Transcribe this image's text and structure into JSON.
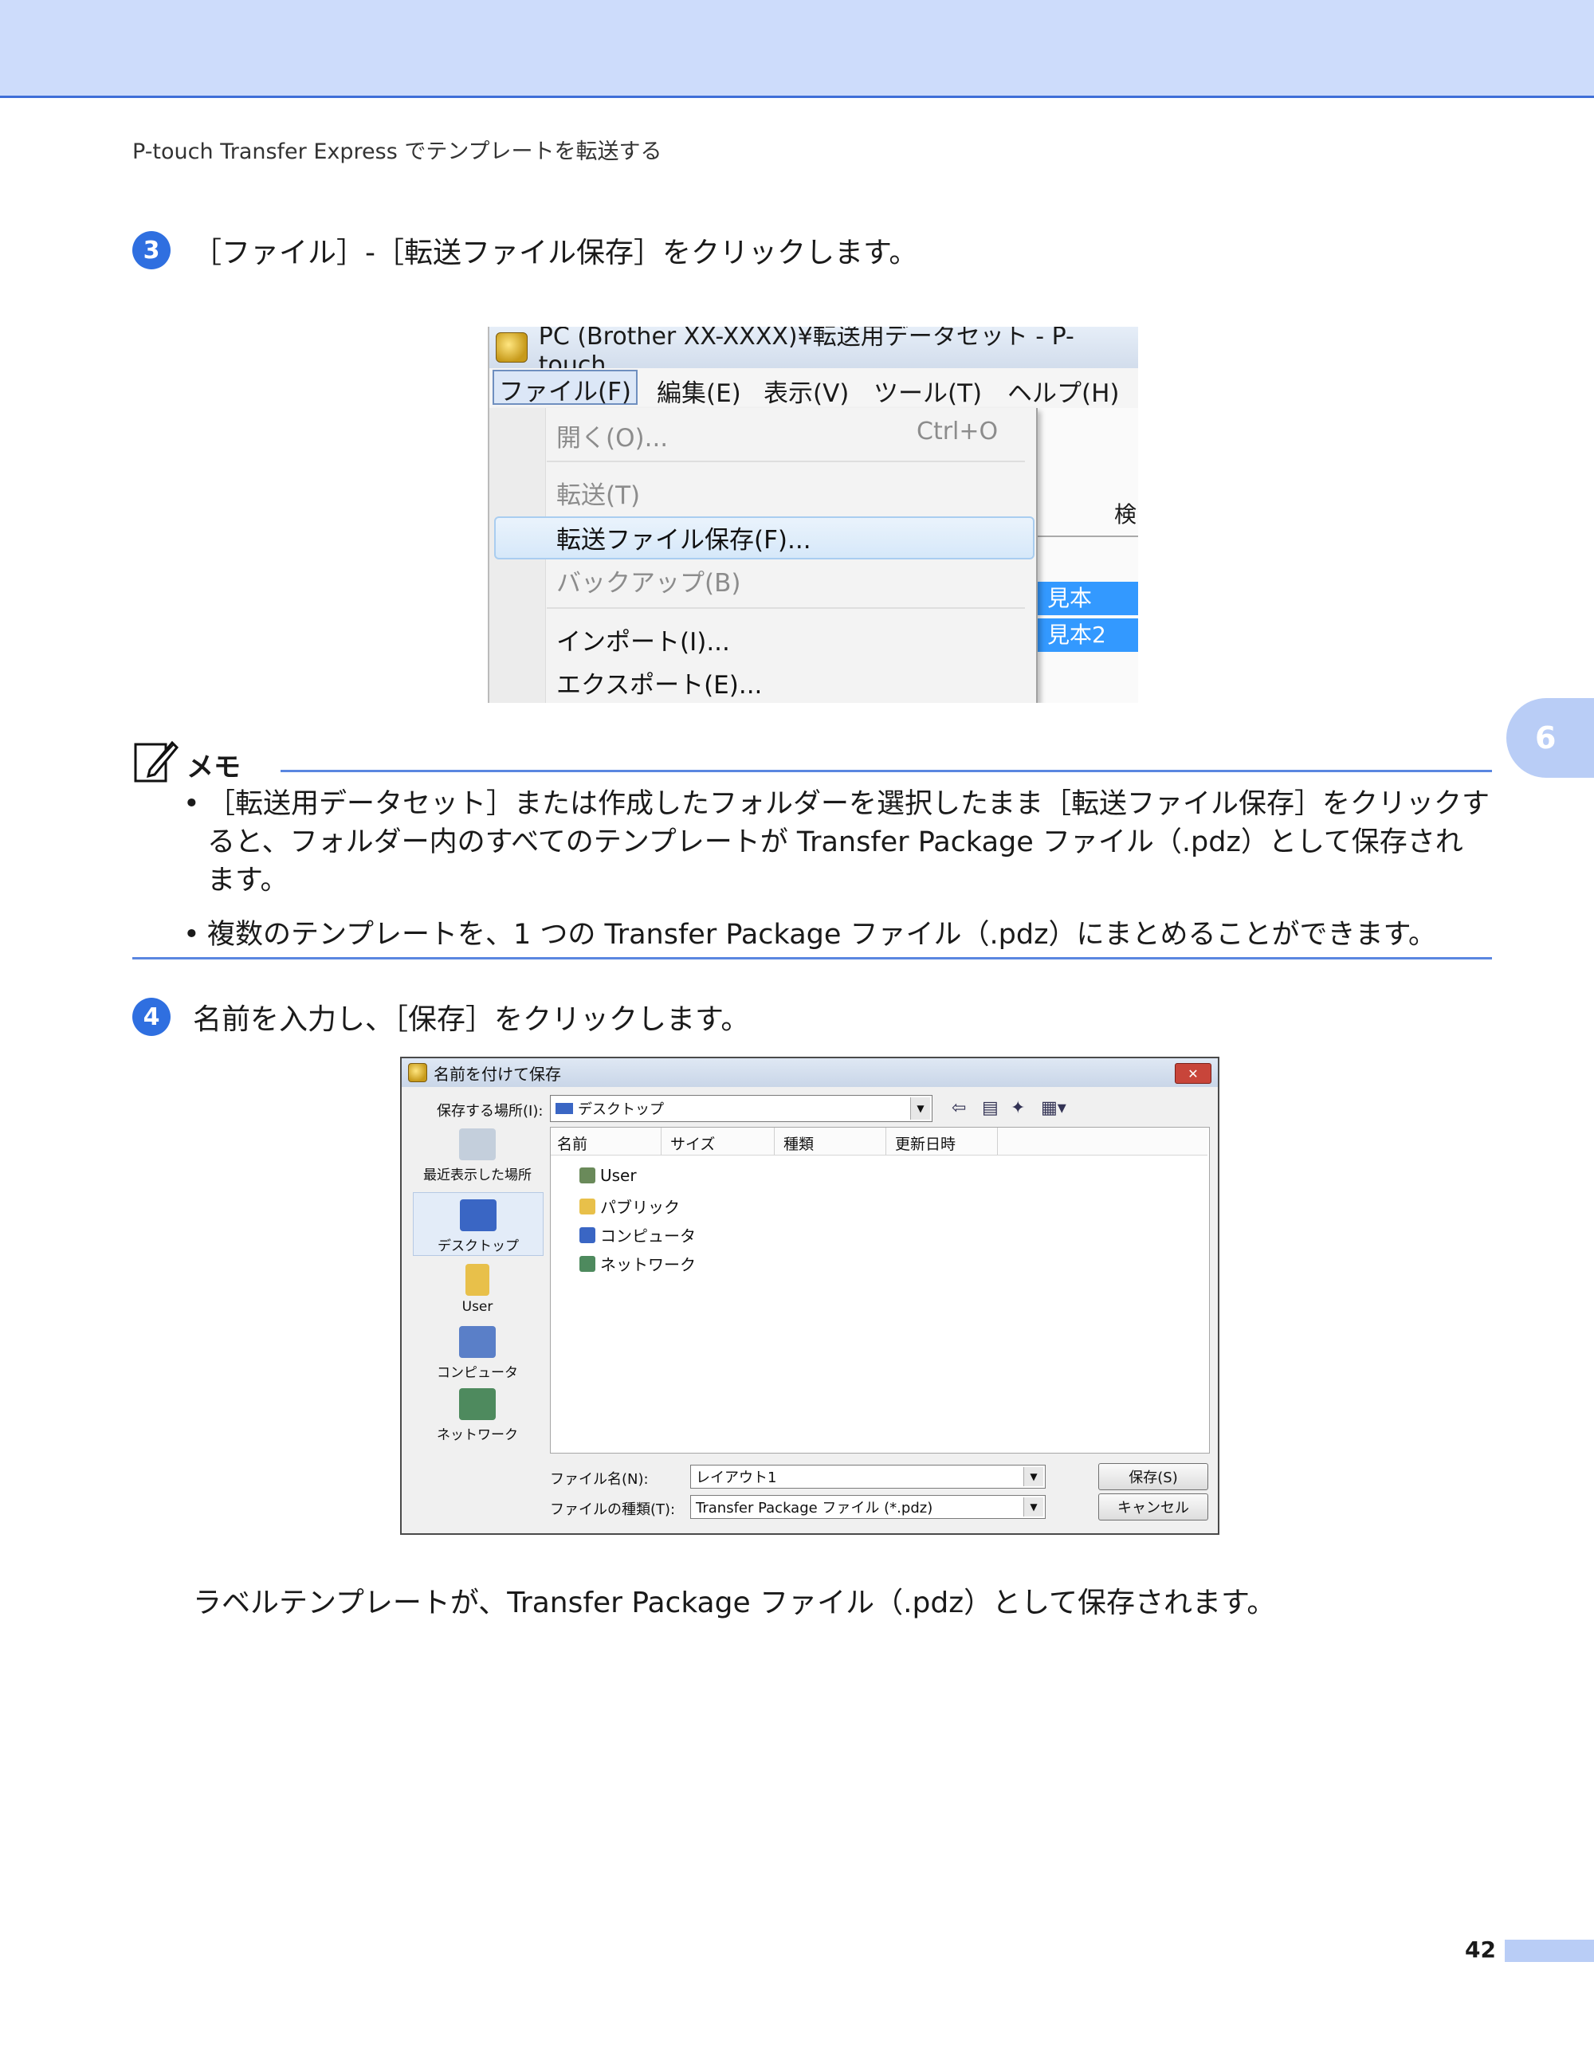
{
  "header": {
    "running_title": "P-touch Transfer Express でテンプレートを転送する"
  },
  "step3": {
    "number": "3",
    "text": "［ファイル］-［転送ファイル保存］をクリックします。"
  },
  "menu_screenshot": {
    "window_title": "PC (Brother XX-XXXX)¥転送用データセット - P-touch",
    "menubar": [
      "ファイル(F)",
      "編集(E)",
      "表示(V)",
      "ツール(T)",
      "ヘルプ(H)"
    ],
    "items": {
      "open": "開く(O)...",
      "open_shortcut": "Ctrl+O",
      "transfer": "転送(T)",
      "save_transfer_file": "転送ファイル保存(F)...",
      "backup": "バックアップ(B)",
      "import": "インポート(I)...",
      "export": "エクスポート(E)..."
    },
    "right_panel": {
      "search_label": "検",
      "row1": "見本",
      "row2": "見本2"
    }
  },
  "side_tab": {
    "label": "6"
  },
  "memo": {
    "title": "メモ",
    "items": [
      "［転送用データセット］または作成したフォルダーを選択したまま［転送ファイル保存］をクリックすると、フォルダー内のすべてのテンプレートが Transfer Package ファイル（.pdz）として保存されます。",
      "複数のテンプレートを、1 つの Transfer Package ファイル（.pdz）にまとめることができます。"
    ],
    "bullet": "•"
  },
  "step4": {
    "number": "4",
    "text": "名前を入力し、［保存］をクリックします。"
  },
  "save_dialog": {
    "title": "名前を付けて保存",
    "close_label": "✕",
    "save_in_label": "保存する場所(I):",
    "save_in_value": "デスクトップ",
    "places": [
      "最近表示した場所",
      "デスクトップ",
      "User",
      "コンピュータ",
      "ネットワーク"
    ],
    "columns": [
      "名前",
      "サイズ",
      "種類",
      "更新日時"
    ],
    "files": [
      "User",
      "パブリック",
      "コンピュータ",
      "ネットワーク"
    ],
    "filename_label": "ファイル名(N):",
    "filename_value": "レイアウト1",
    "filetype_label": "ファイルの種類(T):",
    "filetype_value": "Transfer Package ファイル (*.pdz)",
    "save_button": "保存(S)",
    "cancel_button": "キャンセル"
  },
  "result_text": "ラベルテンプレートが、Transfer Package ファイル（.pdz）として保存されます。",
  "page_number": "42",
  "colors": {
    "accent": "#2f6fe0",
    "band": "#cddcfb",
    "rule": "#5a86e0",
    "highlight_row": "#3399ff"
  }
}
